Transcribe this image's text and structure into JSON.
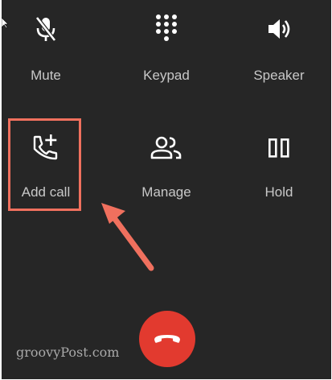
{
  "call_controls": {
    "mute": {
      "label": "Mute",
      "icon": "mic-off-icon"
    },
    "keypad": {
      "label": "Keypad",
      "icon": "dialpad-icon"
    },
    "speaker": {
      "label": "Speaker",
      "icon": "volume-icon"
    },
    "add_call": {
      "label": "Add call",
      "icon": "phone-add-icon"
    },
    "manage": {
      "label": "Manage",
      "icon": "people-icon"
    },
    "hold": {
      "label": "Hold",
      "icon": "pause-icon"
    }
  },
  "end_call": {
    "icon": "hang-up-icon",
    "color": "#e23a2f"
  },
  "annotation": {
    "highlight_color": "#f0705e",
    "arrow_color": "#f0705e"
  },
  "watermark": {
    "text": "groovyPost.com"
  },
  "colors": {
    "background": "#262626",
    "icon": "#ffffff",
    "label": "#c8c8c8"
  }
}
